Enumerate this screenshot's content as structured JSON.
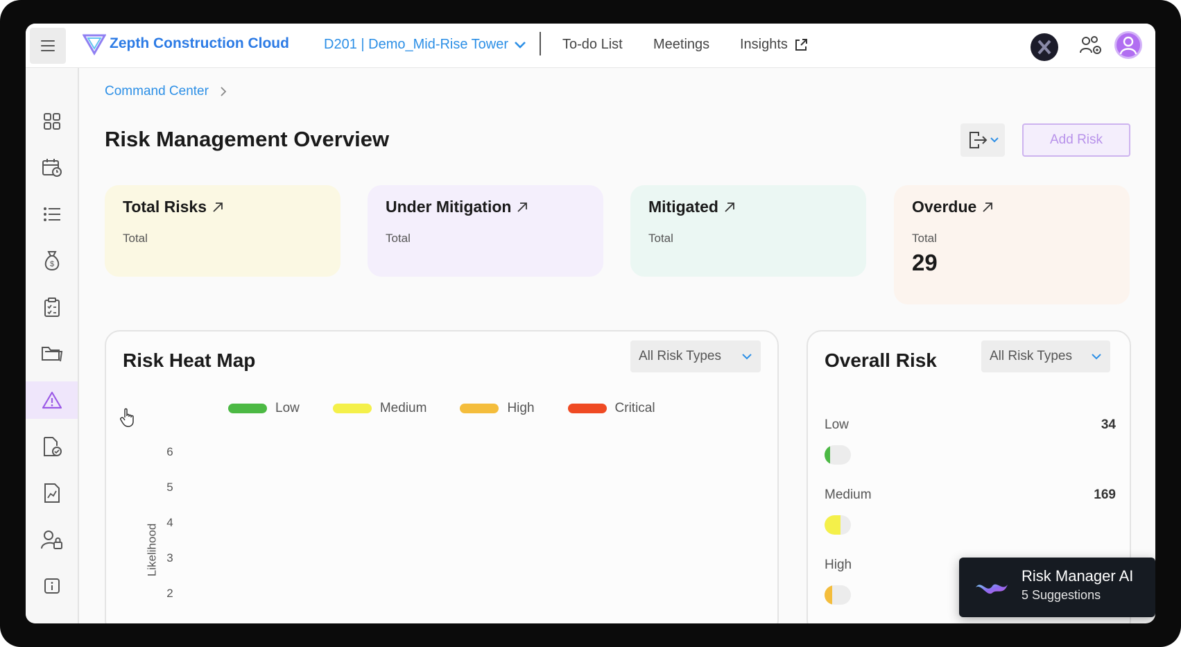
{
  "app": {
    "brand": "Zepth Construction Cloud",
    "project": "D201 | Demo_Mid-Rise Tower",
    "nav": {
      "todo": "To-do List",
      "meetings": "Meetings",
      "insights": "Insights"
    }
  },
  "sidebar": {
    "items": [
      {
        "icon": "dashboard-grid-icon",
        "active": false
      },
      {
        "icon": "calendar-clock-icon",
        "active": false
      },
      {
        "icon": "list-icon",
        "active": false
      },
      {
        "icon": "money-bag-icon",
        "active": false
      },
      {
        "icon": "clipboard-checklist-icon",
        "active": false
      },
      {
        "icon": "folder-icon",
        "active": false
      },
      {
        "icon": "warning-triangle-icon",
        "active": true
      },
      {
        "icon": "document-check-icon",
        "active": false
      },
      {
        "icon": "chart-report-icon",
        "active": false
      },
      {
        "icon": "user-lock-icon",
        "active": false
      },
      {
        "icon": "info-icon",
        "active": false
      },
      {
        "icon": "gear-icon",
        "active": false
      }
    ]
  },
  "breadcrumb": {
    "root": "Command Center"
  },
  "page": {
    "title": "Risk Management Overview",
    "add_risk_label": "Add Risk"
  },
  "stats": {
    "total": {
      "label": "Total Risks",
      "sub": "Total",
      "value": ""
    },
    "under_mitigation": {
      "label": "Under Mitigation",
      "sub": "Total",
      "value": ""
    },
    "mitigated": {
      "label": "Mitigated",
      "sub": "Total",
      "value": ""
    },
    "overdue": {
      "label": "Overdue",
      "sub": "Total",
      "value": "29"
    }
  },
  "heatmap": {
    "title": "Risk Heat Map",
    "filter": "All Risk Types",
    "legend": [
      {
        "label": "Low",
        "color": "#4cb944"
      },
      {
        "label": "Medium",
        "color": "#f4f04a"
      },
      {
        "label": "High",
        "color": "#f4bd3c"
      },
      {
        "label": "Critical",
        "color": "#ef4a23"
      }
    ],
    "y_label": "Likelihood",
    "y_ticks": [
      "6",
      "5",
      "4",
      "3",
      "2"
    ]
  },
  "overall": {
    "title": "Overall Risk",
    "filter": "All Risk Types",
    "rows": [
      {
        "label": "Low",
        "count": "34",
        "color": "#4cb944",
        "fill": 0.2
      },
      {
        "label": "Medium",
        "count": "169",
        "color": "#f4f04a",
        "fill": 0.6
      },
      {
        "label": "High",
        "count": "",
        "color": "#f4bd3c",
        "fill": 0.3
      }
    ]
  },
  "ai_toast": {
    "title": "Risk Manager AI",
    "subtitle": "5 Suggestions"
  }
}
